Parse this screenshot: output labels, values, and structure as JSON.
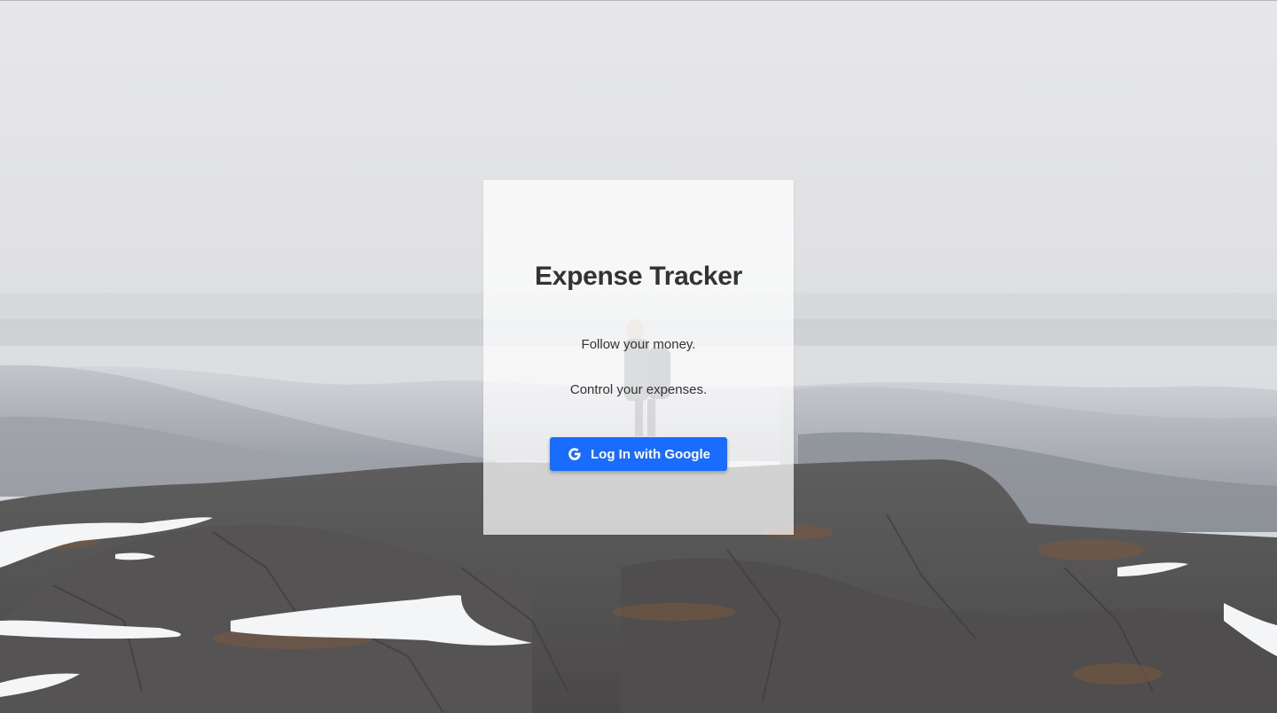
{
  "app": {
    "title": "Expense Tracker"
  },
  "login_card": {
    "title": "Expense Tracker",
    "taglines": [
      "Follow your money.",
      "Control your expenses."
    ],
    "login_button_label": "Log In with Google",
    "login_button_icon": "google-g-icon",
    "button_color": "#1a6cff"
  },
  "background": {
    "type": "photo",
    "subject": "hiker on snowy rocky mountain summit"
  }
}
